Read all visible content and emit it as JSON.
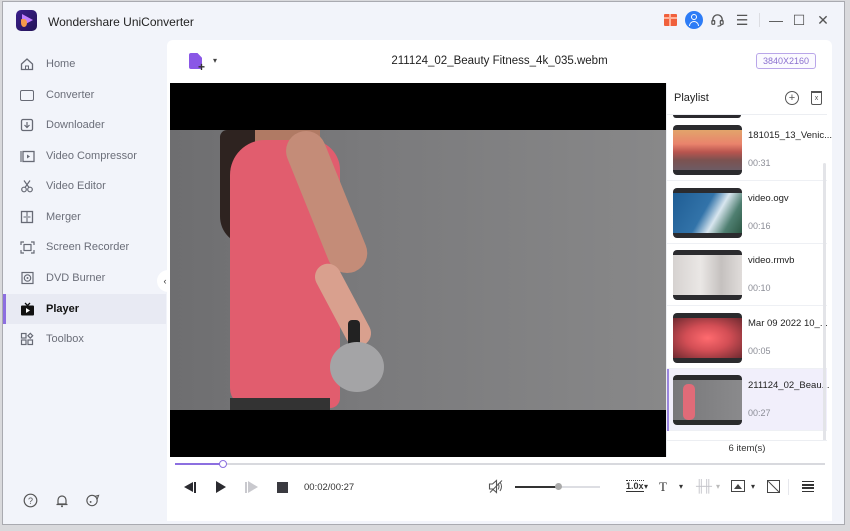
{
  "app": {
    "title": "Wondershare UniConverter"
  },
  "titlebar": {
    "icons": [
      "gift-icon",
      "user-icon",
      "support-headset-icon",
      "menu-icon",
      "minimize-icon",
      "maximize-icon",
      "close-icon"
    ],
    "menu_glyph": "☰",
    "minimize_glyph": "—",
    "maximize_glyph": "☐",
    "close_glyph": "✕",
    "support_glyph": "🎧"
  },
  "sidebar": {
    "items": [
      {
        "label": "Home",
        "icon": "home-icon",
        "active": false
      },
      {
        "label": "Converter",
        "icon": "converter-icon",
        "active": false
      },
      {
        "label": "Downloader",
        "icon": "downloader-icon",
        "active": false
      },
      {
        "label": "Video Compressor",
        "icon": "video-compressor-icon",
        "active": false
      },
      {
        "label": "Video Editor",
        "icon": "scissors-icon",
        "active": false
      },
      {
        "label": "Merger",
        "icon": "merger-icon",
        "active": false
      },
      {
        "label": "Screen Recorder",
        "icon": "screen-recorder-icon",
        "active": false
      },
      {
        "label": "DVD Burner",
        "icon": "dvd-icon",
        "active": false
      },
      {
        "label": "Player",
        "icon": "tv-play-icon",
        "active": true
      },
      {
        "label": "Toolbox",
        "icon": "toolbox-icon",
        "active": false
      }
    ],
    "collapse_glyph": "‹",
    "bottom_icons": [
      "help-icon",
      "notification-bell-icon",
      "feedback-icon"
    ],
    "help_glyph": "?",
    "bell_glyph": "🔔",
    "feedback_glyph": "☺"
  },
  "player": {
    "file_name": "211124_02_Beauty Fitness_4k_035.webm",
    "resolution": "3840X2160",
    "add_plus_glyph": "+",
    "caret_glyph": "▾",
    "progress_fraction": 0.074,
    "time_display": "00:02/00:27",
    "volume_fraction": 0.5,
    "speed_label": "1.0x",
    "subtitle_glyph": "T",
    "audio_track_glyph": "╫╫",
    "muted": true
  },
  "playlist": {
    "title": "Playlist",
    "add_glyph": "+",
    "trash_glyph": "x",
    "items": [
      {
        "name": "181015_13_Venic...",
        "duration": "00:31",
        "thumb": "t-venice",
        "active": false
      },
      {
        "name": "video.ogv",
        "duration": "00:16",
        "thumb": "t-ogv",
        "active": false
      },
      {
        "name": "video.rmvb",
        "duration": "00:10",
        "thumb": "t-rmvb",
        "active": false
      },
      {
        "name": "Mar 09 2022 10_...",
        "duration": "00:05",
        "thumb": "t-mar",
        "active": false
      },
      {
        "name": "211124_02_Beau...",
        "duration": "00:27",
        "thumb": "t-beauty",
        "active": true
      }
    ],
    "count_label": "6 item(s)"
  },
  "colors": {
    "accent": "#8c6fe0",
    "user_badge": "#2d7cf6",
    "gift": "#f0603c"
  }
}
